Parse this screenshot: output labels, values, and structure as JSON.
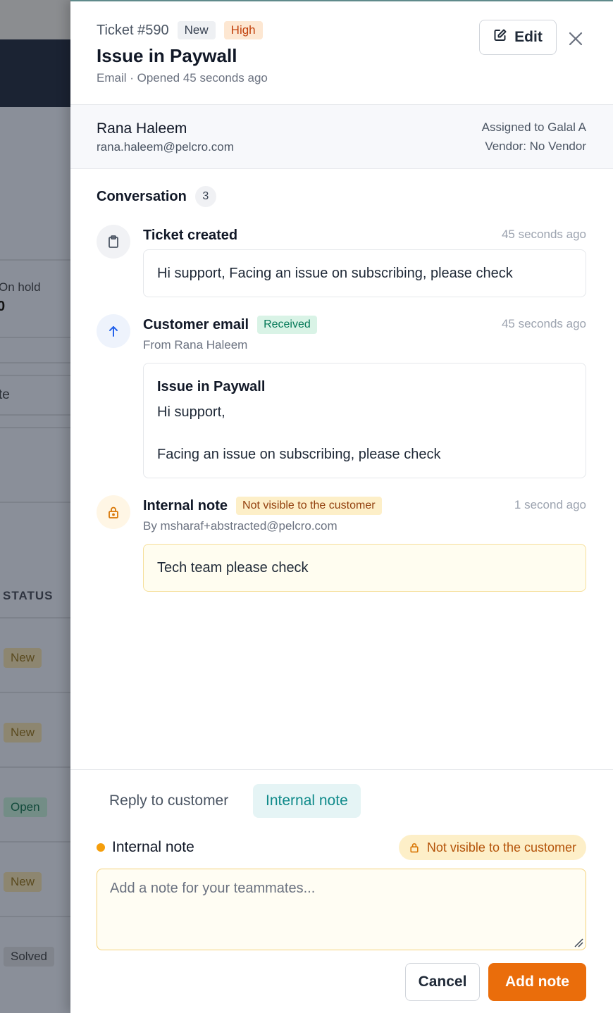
{
  "background": {
    "stat_label": "On hold",
    "stat_value": "0",
    "fragment": "te",
    "status_header": "STATUS",
    "statuses": [
      "New",
      "New",
      "Open",
      "New",
      "Solved"
    ]
  },
  "header": {
    "ticket_id": "Ticket #590",
    "status_badge": "New",
    "priority_badge": "High",
    "title": "Issue in Paywall",
    "subtitle": "Email · Opened 45 seconds ago",
    "edit_label": "Edit"
  },
  "customer": {
    "name": "Rana Haleem",
    "email": "rana.haleem@pelcro.com",
    "assigned": "Assigned to Galal A",
    "vendor": "Vendor: No Vendor"
  },
  "conversation": {
    "title": "Conversation",
    "count": "3",
    "events": [
      {
        "title": "Ticket created",
        "time": "45 seconds ago",
        "body": "Hi support, Facing an issue on subscribing, please check",
        "icon": "clipboard-icon"
      },
      {
        "title": "Customer email",
        "tag": "Received",
        "time": "45 seconds ago",
        "from": "From Rana Haleem",
        "subject": "Issue in Paywall",
        "body_line1": "Hi support,",
        "body_line2": "Facing an issue on subscribing, please check",
        "icon": "arrow-up-icon"
      },
      {
        "title": "Internal note",
        "tag": "Not visible to the customer",
        "time": "1 second ago",
        "by": "By msharaf+abstracted@pelcro.com",
        "body": "Tech team please check",
        "icon": "lock-icon"
      }
    ]
  },
  "composer": {
    "tab_reply": "Reply to customer",
    "tab_internal": "Internal note",
    "label": "Internal note",
    "visibility_pill": "Not visible to the customer",
    "placeholder": "Add a note for your teammates...",
    "cancel_label": "Cancel",
    "submit_label": "Add note"
  },
  "colors": {
    "accent": "#ea6d0b",
    "teal": "#0f8a8a",
    "high": "#c2410c",
    "received": "#047857",
    "internal": "#92400e"
  }
}
